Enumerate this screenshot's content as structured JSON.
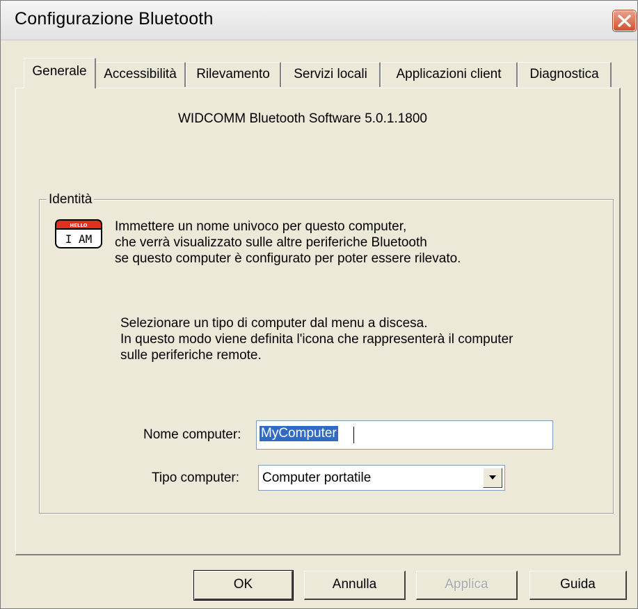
{
  "window": {
    "title": "Configurazione Bluetooth",
    "close_icon": "close-icon",
    "accent_color": "#d4512f"
  },
  "tabs": [
    {
      "label": "Generale",
      "active": true
    },
    {
      "label": "Accessibilità",
      "active": false
    },
    {
      "label": "Rilevamento",
      "active": false
    },
    {
      "label": "Servizi locali",
      "active": false
    },
    {
      "label": "Applicazioni client",
      "active": false
    },
    {
      "label": "Diagnostica",
      "active": false
    }
  ],
  "general": {
    "version_text": "WIDCOMM Bluetooth Software 5.0.1.1800",
    "identity": {
      "group_label": "Identità",
      "icon": "hello-i-am-badge-icon",
      "icon_text_small": "HELLO",
      "icon_text_main": "I AM",
      "description_lines": [
        "Immettere un nome univoco per questo computer,",
        "che verrà visualizzato sulle altre periferiche Bluetooth",
        "se questo computer è configurato per poter essere rilevato."
      ],
      "type_help_lines": [
        "Selezionare un tipo di computer dal menu a discesa.",
        "In questo modo viene definita l'icona che rappresenterà il computer",
        "sulle periferiche remote."
      ],
      "computer_name_label": "Nome computer:",
      "computer_name_value": "MyComputer",
      "computer_type_label": "Tipo computer:",
      "computer_type_value": "Computer portatile",
      "dropdown_icon": "chevron-down-icon"
    }
  },
  "buttons": {
    "ok": "OK",
    "cancel": "Annulla",
    "apply": "Applica",
    "help": "Guida"
  }
}
